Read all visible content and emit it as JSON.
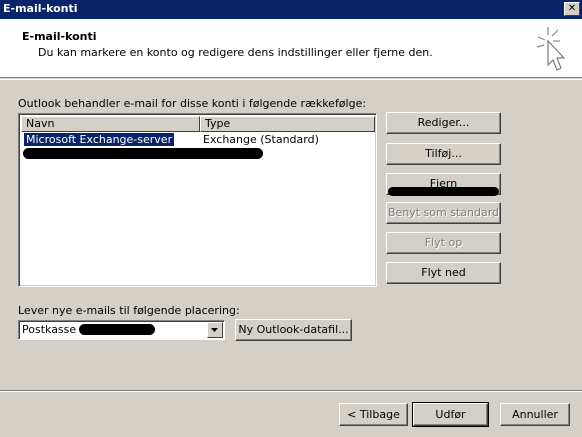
{
  "window": {
    "title": "E-mail-konti",
    "close_glyph": "✕"
  },
  "header": {
    "title": "E-mail-konti",
    "subtitle": "Du kan markere en konto og redigere dens indstillinger eller fjerne den.",
    "icon": "wizard-cursor-icon"
  },
  "accounts": {
    "caption": "Outlook behandler e-mail for disse konti i følgende rækkefølge:",
    "columns": [
      "Navn",
      "Type"
    ],
    "rows": [
      {
        "name": "Microsoft Exchange-server",
        "type": "Exchange (Standard)",
        "selected": true
      },
      {
        "name": "",
        "type": "",
        "redacted": true
      }
    ]
  },
  "side_buttons": {
    "edit": "Rediger...",
    "add": "Tilføj...",
    "remove": "Fjern",
    "set_default": "Benyt som standard",
    "move_up": "Flyt op",
    "move_down": "Flyt ned"
  },
  "delivery": {
    "caption": "Lever nye e-mails til følgende placering:",
    "selected": "Postkasse -",
    "new_datafile_button": "Ny Outlook-datafil..."
  },
  "footer": {
    "back": "< Tilbage",
    "finish": "Udfør",
    "cancel": "Annuller"
  },
  "colors": {
    "titlebar": "#0a246a",
    "face": "#d4d0c8",
    "selection": "#0a246a"
  }
}
